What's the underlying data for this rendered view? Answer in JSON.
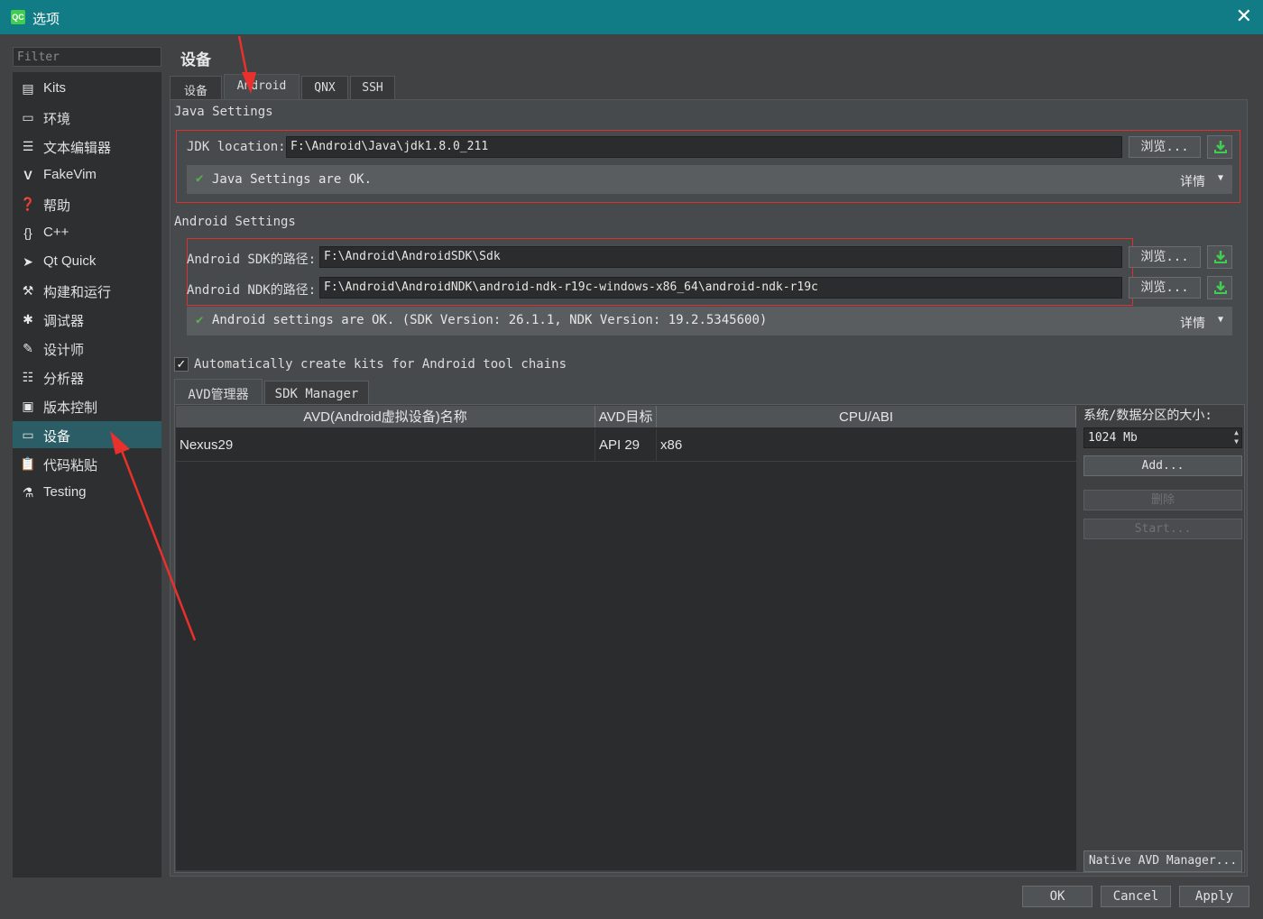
{
  "window": {
    "title": "选项",
    "app_icon": "QC",
    "close": "✕"
  },
  "filter": {
    "placeholder": "Filter"
  },
  "sidebar": {
    "items": [
      {
        "label": "Kits",
        "icon": "kits-icon"
      },
      {
        "label": "环境",
        "icon": "monitor-icon"
      },
      {
        "label": "文本编辑器",
        "icon": "text-editor-icon"
      },
      {
        "label": "FakeVim",
        "icon": "fakevim-icon"
      },
      {
        "label": "帮助",
        "icon": "help-icon"
      },
      {
        "label": "C++",
        "icon": "braces-icon"
      },
      {
        "label": "Qt Quick",
        "icon": "qt-quick-icon"
      },
      {
        "label": "构建和运行",
        "icon": "hammer-icon"
      },
      {
        "label": "调试器",
        "icon": "bug-icon"
      },
      {
        "label": "设计师",
        "icon": "pencil-icon"
      },
      {
        "label": "分析器",
        "icon": "analyzer-icon"
      },
      {
        "label": "版本控制",
        "icon": "version-control-icon"
      },
      {
        "label": "设备",
        "icon": "device-icon"
      },
      {
        "label": "代码粘贴",
        "icon": "clipboard-icon"
      },
      {
        "label": "Testing",
        "icon": "flask-icon"
      }
    ],
    "selected": "设备"
  },
  "page": {
    "title": "设备"
  },
  "tabs": [
    {
      "label": "设备"
    },
    {
      "label": "Android"
    },
    {
      "label": "QNX"
    },
    {
      "label": "SSH"
    }
  ],
  "java": {
    "section": "Java Settings",
    "jdk_label": "JDK location:",
    "jdk_value": "F:\\Android\\Java\\jdk1.8.0_211",
    "browse": "浏览...",
    "status": "Java Settings are OK.",
    "details": "详情"
  },
  "android": {
    "section": "Android Settings",
    "sdk_label": "Android SDK的路径:",
    "sdk_value": "F:\\Android\\AndroidSDK\\Sdk",
    "ndk_label": "Android NDK的路径:",
    "ndk_value": "F:\\Android\\AndroidNDK\\android-ndk-r19c-windows-x86_64\\android-ndk-r19c",
    "browse": "浏览...",
    "status": "Android settings are OK. (SDK Version: 26.1.1, NDK Version: 19.2.5345600)",
    "details": "详情"
  },
  "auto_kits": {
    "label": "Automatically create kits for Android tool chains",
    "checked": true
  },
  "avd_tabs": [
    {
      "label": "AVD管理器"
    },
    {
      "label": "SDK Manager"
    }
  ],
  "avd_table": {
    "headers": [
      "AVD(Android虚拟设备)名称",
      "AVD目标",
      "CPU/ABI"
    ],
    "rows": [
      [
        "Nexus29",
        "API 29",
        "x86"
      ]
    ]
  },
  "avd_side": {
    "size_label": "系统/数据分区的大小:",
    "size_value": "1024 Mb",
    "add": "Add...",
    "delete": "删除",
    "start": "Start...",
    "native": "Native AVD Manager..."
  },
  "footer": {
    "ok": "OK",
    "cancel": "Cancel",
    "apply": "Apply"
  },
  "colors": {
    "titlebar": "#117c86",
    "selection": "#2b5d66",
    "highlight_box": "#e0302a",
    "ok_check": "#59b14c",
    "download": "#41cd52"
  }
}
